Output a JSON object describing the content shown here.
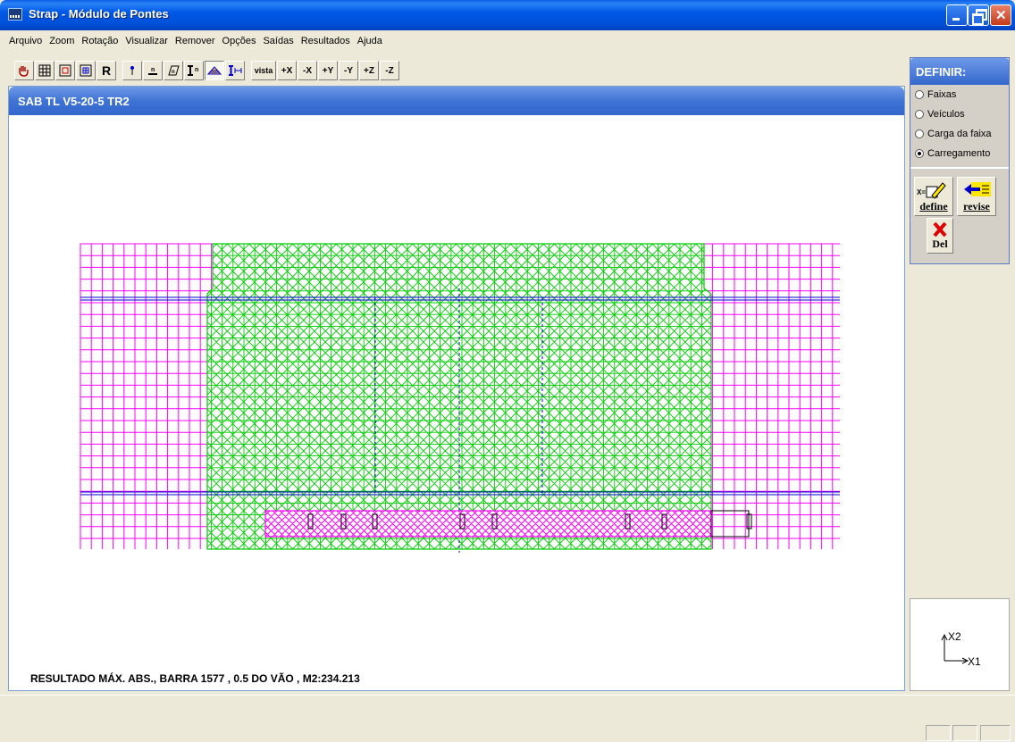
{
  "window": {
    "title": "Strap - Módulo de Pontes"
  },
  "menu": [
    "Arquivo",
    "Zoom",
    "Rotação",
    "Visualizar",
    "Remover",
    "Opções",
    "Saídas",
    "Resultados",
    "Ajuda"
  ],
  "toolbar": {
    "r_label": "R",
    "vista_label": "vista",
    "px": "+X",
    "mx": "-X",
    "py": "+Y",
    "my": "-Y",
    "pz": "+Z",
    "mz": "-Z"
  },
  "drawing": {
    "title": "SAB TL V5-20-5 TR2",
    "result_text": "RESULTADO MÁX. ABS., BARRA 1577 , 0.5 DO VÃO ,  M2:234.213",
    "colors": {
      "grid": "#ff00ff",
      "load_zone": "#00cc00",
      "lanes": "#0000cc",
      "vehicle": "#ff00ff"
    }
  },
  "define_panel": {
    "title": "DEFINIR:",
    "options": [
      {
        "label": "Faixas",
        "checked": false
      },
      {
        "label": "Veículos",
        "checked": false
      },
      {
        "label": "Carga da faixa",
        "checked": false
      },
      {
        "label": "Carregamento",
        "checked": true
      }
    ],
    "define_label": "define",
    "revise_label": "revise",
    "del_label": "Del"
  },
  "axes": {
    "x1": "X1",
    "x2": "X2"
  }
}
